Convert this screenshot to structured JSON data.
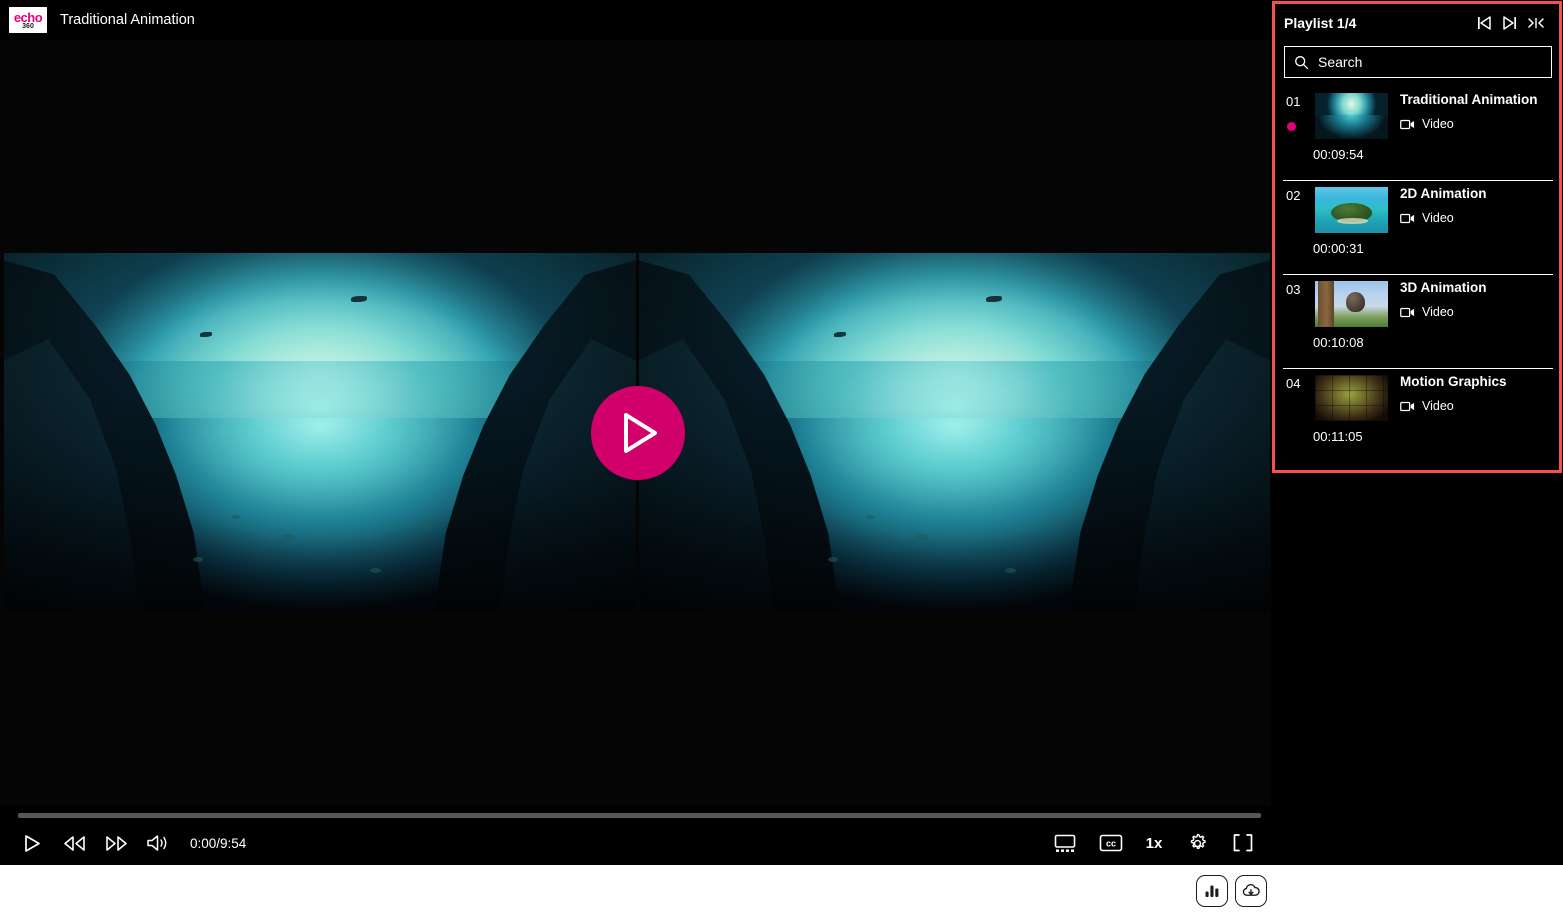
{
  "header": {
    "logo_line1": "echo",
    "logo_line2": "360",
    "logo_name": "echo360-logo",
    "media_title": "Traditional Animation"
  },
  "player": {
    "play_overlay_label": "Play",
    "controls": {
      "play_label": "Play",
      "rewind_label": "Rewind",
      "forward_label": "Fast forward",
      "volume_label": "Volume",
      "timecode": "0:00/9:54",
      "current_time": "0:00",
      "duration": "9:54",
      "progress_percent": 0,
      "layout_label": "Change layout",
      "captions_label": "CC",
      "speed_label": "1x",
      "settings_label": "Settings",
      "fullscreen_label": "Fullscreen"
    }
  },
  "playlist": {
    "title": "Playlist 1/4",
    "current_index": 1,
    "total": 4,
    "previous_label": "Previous",
    "next_label": "Next",
    "collapse_label": "Collapse",
    "search": {
      "placeholder": "Search",
      "value": ""
    },
    "items": [
      {
        "number": "01",
        "name": "Traditional Animation",
        "type": "Video",
        "duration": "00:09:54",
        "thumb_class": "t-underwater",
        "active": true
      },
      {
        "number": "02",
        "name": "2D Animation",
        "type": "Video",
        "duration": "00:00:31",
        "thumb_class": "t-island",
        "active": false
      },
      {
        "number": "03",
        "name": "3D Animation",
        "type": "Video",
        "duration": "00:10:08",
        "thumb_class": "t-3d",
        "active": false
      },
      {
        "number": "04",
        "name": "Motion Graphics",
        "type": "Video",
        "duration": "00:11:05",
        "thumb_class": "t-motion",
        "active": false
      }
    ]
  },
  "bottom_bar": {
    "analytics_label": "Analytics",
    "download_label": "Download"
  },
  "colors": {
    "accent_pink": "#d1006b",
    "dot_pink": "#e0007a",
    "highlight_border": "#f2534d",
    "panel_bg": "#000000",
    "player_bg": "#050505"
  }
}
